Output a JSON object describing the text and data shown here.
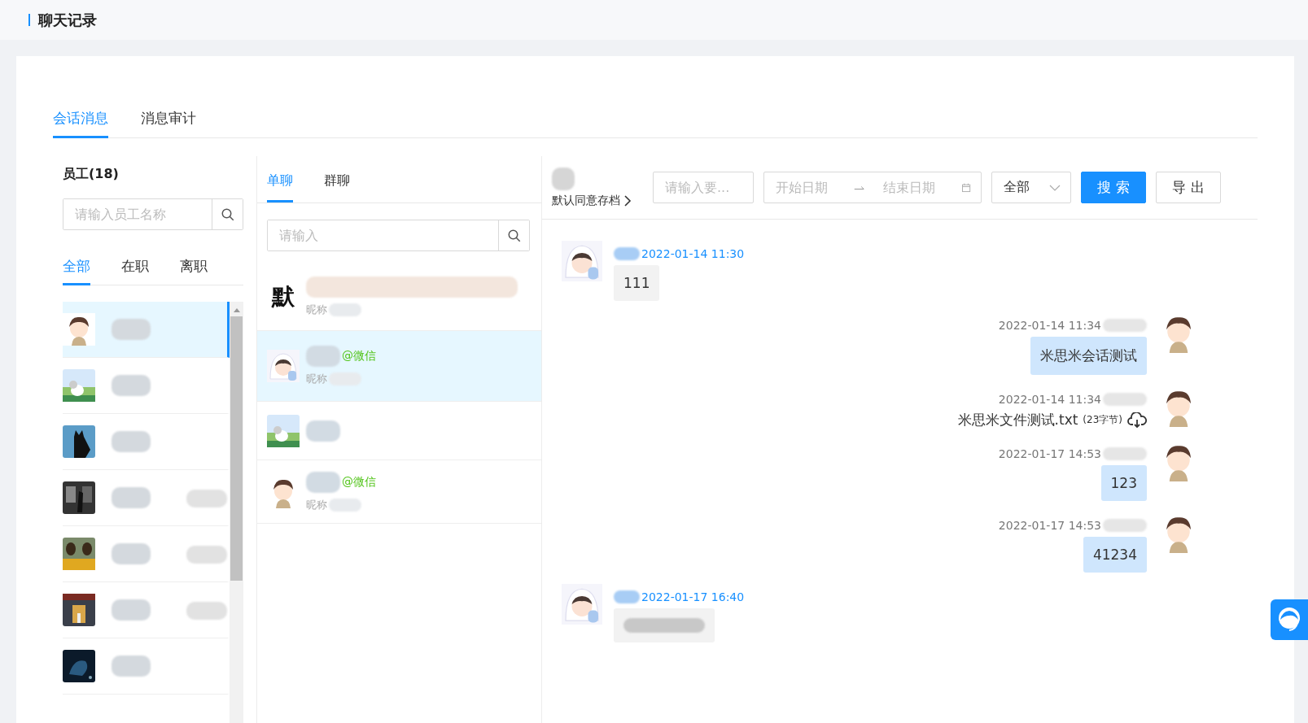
{
  "header": {
    "title": "聊天记录"
  },
  "tabs": [
    {
      "label": "会话消息",
      "selected": true
    },
    {
      "label": "消息审计",
      "selected": false
    }
  ],
  "employees": {
    "title": "员工(18)",
    "search": {
      "placeholder": "请输入员工名称"
    },
    "filters": [
      {
        "label": "全部",
        "selected": true
      },
      {
        "label": "在职",
        "selected": false
      },
      {
        "label": "离职",
        "selected": false
      }
    ],
    "items": [
      {
        "avatar": {
          "kind": "boy"
        },
        "selected": true,
        "extra": false
      },
      {
        "avatar": {
          "kind": "meadow"
        },
        "selected": false,
        "extra": false
      },
      {
        "avatar": {
          "kind": "cat"
        },
        "selected": false,
        "extra": false
      },
      {
        "avatar": {
          "kind": "street"
        },
        "selected": false,
        "extra": true
      },
      {
        "avatar": {
          "kind": "yellow"
        },
        "selected": false,
        "extra": true
      },
      {
        "avatar": {
          "kind": "building"
        },
        "selected": false,
        "extra": true
      },
      {
        "avatar": {
          "kind": "night"
        },
        "selected": false,
        "extra": false
      }
    ]
  },
  "conversations": {
    "tabs": [
      {
        "label": "单聊",
        "selected": true
      },
      {
        "label": "群聊",
        "selected": false
      }
    ],
    "search": {
      "placeholder": "请输入"
    },
    "items": [
      {
        "avatar": {
          "kind": "glyph",
          "text": "默"
        },
        "nickname_label": "昵称",
        "selected": false
      },
      {
        "avatar": {
          "kind": "girl"
        },
        "source": "@微信",
        "nickname_label": "昵称",
        "selected": true
      },
      {
        "avatar": {
          "kind": "meadow"
        },
        "selected": false
      },
      {
        "avatar": {
          "kind": "boy"
        },
        "source": "@微信",
        "nickname_label": "昵称",
        "selected": false
      }
    ]
  },
  "chat": {
    "archive_link": "默认同意存档",
    "keyword": {
      "placeholder": "请输入要..."
    },
    "date_range": {
      "start_placeholder": "开始日期",
      "end_placeholder": "结束日期"
    },
    "type_select": {
      "value": "全部"
    },
    "buttons": [
      {
        "label": "搜 索",
        "kind": "primary"
      },
      {
        "label": "导 出",
        "kind": "default"
      }
    ],
    "messages": [
      {
        "outgoing": false,
        "avatar": {
          "kind": "girl"
        },
        "time": "2022-01-14 11:30",
        "kind": "text",
        "text": "111"
      },
      {
        "outgoing": true,
        "avatar": {
          "kind": "boy"
        },
        "time": "2022-01-14 11:34",
        "kind": "text",
        "text": "米思米会话测试"
      },
      {
        "outgoing": true,
        "avatar": {
          "kind": "boy"
        },
        "time": "2022-01-14 11:34",
        "kind": "file",
        "text": "米思米文件测试.txt",
        "size": "(23字节)"
      },
      {
        "outgoing": true,
        "avatar": {
          "kind": "boy"
        },
        "time": "2022-01-17 14:53",
        "kind": "text",
        "text": "123"
      },
      {
        "outgoing": true,
        "avatar": {
          "kind": "boy"
        },
        "time": "2022-01-17 14:53",
        "kind": "text",
        "text": "41234"
      },
      {
        "outgoing": false,
        "avatar": {
          "kind": "girl"
        },
        "time": "2022-01-17 16:40",
        "kind": "blurred"
      }
    ]
  }
}
